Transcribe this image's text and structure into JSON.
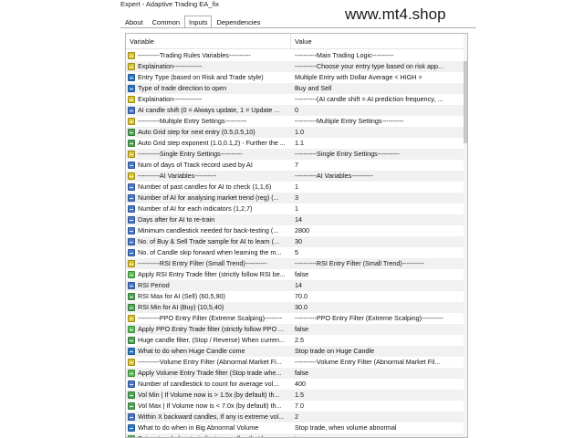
{
  "window": {
    "title": "Expert - Adaptive Trading EA_fix"
  },
  "watermark": "www.mt4.shop",
  "tabs": [
    {
      "label": "About",
      "active": false
    },
    {
      "label": "Common",
      "active": false
    },
    {
      "label": "Inputs",
      "active": true
    },
    {
      "label": "Dependencies",
      "active": false
    }
  ],
  "table": {
    "headers": {
      "variable": "Variable",
      "value": "Value"
    },
    "rows": [
      {
        "icon": "ab",
        "variable": "----------Trading Rules Variables----------",
        "value": "----------Main Trading Logic----------"
      },
      {
        "icon": "ab",
        "variable": "Explaination-------------",
        "value": "----------Choose your entry type based on risk app..."
      },
      {
        "icon": "enum",
        "variable": "Entry Type (based on Risk and Trade style)",
        "value": "Multiple Entry with Dollar Average < HIGH >"
      },
      {
        "icon": "enum",
        "variable": "Type of trade direction to open",
        "value": "Buy and Sell"
      },
      {
        "icon": "ab",
        "variable": "Explaination-------------",
        "value": "----------(AI candle shift = AI prediction frequency, ..."
      },
      {
        "icon": "123",
        "variable": "AI candle shift (0 = Always update, 1 = Update ...",
        "value": "0"
      },
      {
        "icon": "ab",
        "variable": "----------Multiple Entry Settings----------",
        "value": "----------Multiple Entry Settings----------"
      },
      {
        "icon": "12",
        "variable": "Auto Grid step for next entry (0.5,0.5,10)",
        "value": "1.0"
      },
      {
        "icon": "12",
        "variable": "Auto Grid step exponent (1.0,0.1,2) - Further the ...",
        "value": "1.1"
      },
      {
        "icon": "ab",
        "variable": "----------Single Entry Settings----------",
        "value": "----------Single Entry Settings----------"
      },
      {
        "icon": "123",
        "variable": "Num of days of Track record used by AI",
        "value": "7"
      },
      {
        "icon": "ab",
        "variable": "----------AI Variables----------",
        "value": "----------AI Variables----------"
      },
      {
        "icon": "123",
        "variable": "Number of past candles for AI to check (1,1,6)",
        "value": "1"
      },
      {
        "icon": "123",
        "variable": "Number of AI for analysing market trend (reg) (...",
        "value": "3"
      },
      {
        "icon": "123",
        "variable": "Number of AI for each indicators  (1,2,7)",
        "value": "1"
      },
      {
        "icon": "123",
        "variable": "Days after for AI to re-train",
        "value": "14"
      },
      {
        "icon": "123",
        "variable": "Minimum candlestick needed for back-testing (...",
        "value": "2800"
      },
      {
        "icon": "123",
        "variable": "No. of Buy & Sell Trade sample for AI to learn (...",
        "value": "30"
      },
      {
        "icon": "123",
        "variable": "No. of Candle skip forward when learning the m...",
        "value": "5"
      },
      {
        "icon": "ab",
        "variable": "----------RSI Entry Filter (Small Trend)----------",
        "value": "----------RSI Entry Filter (Small Trend)----------"
      },
      {
        "icon": "bool",
        "variable": "Apply RSI Entry Trade filter (strictly follow RSI be...",
        "value": "false"
      },
      {
        "icon": "123",
        "variable": "RSI Period",
        "value": "14"
      },
      {
        "icon": "12",
        "variable": "RSI Max for AI (Sell) (60,5,90)",
        "value": "70.0"
      },
      {
        "icon": "12",
        "variable": "RSI Min for AI (Buy) (10,5,40)",
        "value": "30.0"
      },
      {
        "icon": "ab",
        "variable": "----------PPO Entry Filter (Extreme Scalping)--------",
        "value": "----------PPO Entry Filter (Extreme Scalping)----------"
      },
      {
        "icon": "bool",
        "variable": "Apply PPO Entry Trade filter (strictly follow PPO ...",
        "value": "false"
      },
      {
        "icon": "12",
        "variable": "Huge candle filter, (Stop / Reverse) When curren...",
        "value": "2.5"
      },
      {
        "icon": "enum",
        "variable": "What to do when Huge Candle come",
        "value": "Stop trade on Huge Candle"
      },
      {
        "icon": "ab",
        "variable": "----------Volume Entry Filter (Abnormal Market Fi...",
        "value": "----------Volume Entry Filter (Abnormal Market Fil..."
      },
      {
        "icon": "bool",
        "variable": "Apply Volume Entry Trade filter (Stop trade whe...",
        "value": "false"
      },
      {
        "icon": "123",
        "variable": "Number of candlestick to count for average vol...",
        "value": "400"
      },
      {
        "icon": "12",
        "variable": "Vol Min | If Volume now is > 1.5x (by default) th...",
        "value": "1.5"
      },
      {
        "icon": "12",
        "variable": "Vol Max | If Volume now is < 7.0x (by default) th...",
        "value": "7.0"
      },
      {
        "icon": "123",
        "variable": "Within X backward candles, If any is extreme vol...",
        "value": "2"
      },
      {
        "icon": "enum",
        "variable": "What to do when in Big Abnormal Volume",
        "value": "Stop trade, when volume abnormal"
      },
      {
        "icon": "bool",
        "variable": "Set rectangle box to indicator candles that has ...",
        "value": "true"
      }
    ]
  }
}
